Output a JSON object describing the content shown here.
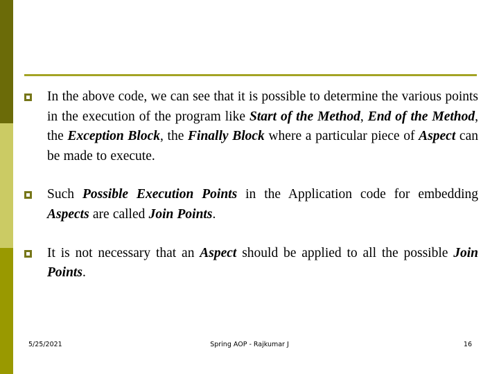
{
  "slide": {
    "background_color": "#ffffff",
    "accent_color": "#999900",
    "rule_color": "#a3a324",
    "bullet_marker_color": "#767619",
    "side_bar": {
      "name": "left-color-bar",
      "bands": [
        {
          "name": "dark-olive-band",
          "color": "#6b6b08"
        },
        {
          "name": "pale-olive-band",
          "color": "#cbcb64"
        },
        {
          "name": "bright-olive-band",
          "color": "#999900"
        }
      ]
    },
    "bullets": [
      {
        "marker": "hollow-square-bullet",
        "runs": [
          {
            "text": "In the above code, we can see that it is possible to determine the various points in the execution of the program like ",
            "emphasis": false
          },
          {
            "text": "Start of the Method",
            "emphasis": true
          },
          {
            "text": ", ",
            "emphasis": false
          },
          {
            "text": "End of the Method",
            "emphasis": true
          },
          {
            "text": ", the ",
            "emphasis": false
          },
          {
            "text": "Exception Block",
            "emphasis": true
          },
          {
            "text": ", the ",
            "emphasis": false
          },
          {
            "text": "Finally Block",
            "emphasis": true
          },
          {
            "text": " where a particular piece of ",
            "emphasis": false
          },
          {
            "text": "Aspect",
            "emphasis": true
          },
          {
            "text": " can be made to execute.",
            "emphasis": false
          }
        ]
      },
      {
        "marker": "hollow-square-bullet",
        "runs": [
          {
            "text": "Such ",
            "emphasis": false
          },
          {
            "text": "Possible Execution Points",
            "emphasis": true
          },
          {
            "text": " in the Application code for embedding ",
            "emphasis": false
          },
          {
            "text": "Aspects",
            "emphasis": true
          },
          {
            "text": " are called ",
            "emphasis": false
          },
          {
            "text": "Join Points",
            "emphasis": true
          },
          {
            "text": ".",
            "emphasis": false
          }
        ]
      },
      {
        "marker": "hollow-square-bullet",
        "runs": [
          {
            "text": "It is not necessary that an ",
            "emphasis": false
          },
          {
            "text": "Aspect",
            "emphasis": true
          },
          {
            "text": " should be applied to all the possible ",
            "emphasis": false
          },
          {
            "text": "Join Points",
            "emphasis": true
          },
          {
            "text": ".",
            "emphasis": false
          }
        ]
      }
    ],
    "footer": {
      "date": "5/25/2021",
      "center": "Spring AOP  -  Rajkumar J",
      "page_number": "16"
    }
  }
}
